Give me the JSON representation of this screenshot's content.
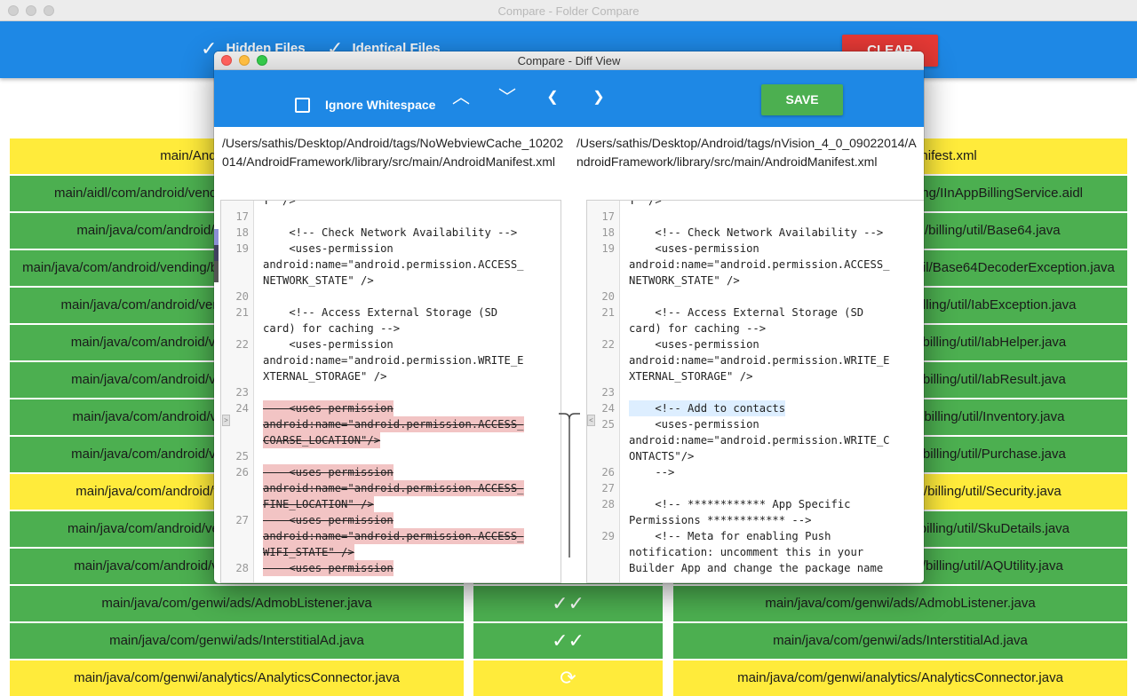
{
  "main_window": {
    "title": "Compare - Folder Compare",
    "toolbar": {
      "hidden_files_label": "Hidden Files",
      "identical_files_label": "Identical Files",
      "check_glyph": "✓",
      "clear_label": "CLEAR"
    },
    "rows": [
      {
        "left": "main/AndroidManifest.xml",
        "right": "main/AndroidManifest.xml",
        "status": "changed",
        "icon": "",
        "color": "#ffeb3b"
      },
      {
        "left": "main/aidl/com/android/vending/billing/IInAppBillingService.aidl",
        "right": "main/aidl/com/android/vending/billing/IInAppBillingService.aidl",
        "status": "identical",
        "icon": "",
        "color": "#4caf50"
      },
      {
        "left": "main/java/com/android/vending/billing/util/Base64.java",
        "right": "main/java/com/android/vending/billing/util/Base64.java",
        "status": "identical",
        "icon": "",
        "color": "#4caf50"
      },
      {
        "left": "main/java/com/android/vending/billing/util/Base64DecoderException.java",
        "right": "main/java/com/android/vending/billing/util/Base64DecoderException.java",
        "status": "identical",
        "icon": "",
        "color": "#4caf50"
      },
      {
        "left": "main/java/com/android/vending/billing/util/IabException.java",
        "right": "main/java/com/android/vending/billing/util/IabException.java",
        "status": "identical",
        "icon": "",
        "color": "#4caf50"
      },
      {
        "left": "main/java/com/android/vending/billing/util/IabHelper.java",
        "right": "main/java/com/android/vending/billing/util/IabHelper.java",
        "status": "identical",
        "icon": "",
        "color": "#4caf50"
      },
      {
        "left": "main/java/com/android/vending/billing/util/IabResult.java",
        "right": "main/java/com/android/vending/billing/util/IabResult.java",
        "status": "identical",
        "icon": "",
        "color": "#4caf50"
      },
      {
        "left": "main/java/com/android/vending/billing/util/Inventory.java",
        "right": "main/java/com/android/vending/billing/util/Inventory.java",
        "status": "identical",
        "icon": "",
        "color": "#4caf50"
      },
      {
        "left": "main/java/com/android/vending/billing/util/Purchase.java",
        "right": "main/java/com/android/vending/billing/util/Purchase.java",
        "status": "identical",
        "icon": "",
        "color": "#4caf50"
      },
      {
        "left": "main/java/com/android/vending/billing/util/Security.java",
        "right": "main/java/com/android/vending/billing/util/Security.java",
        "status": "changed",
        "icon": "",
        "color": "#ffeb3b"
      },
      {
        "left": "main/java/com/android/vending/billing/util/SkuDetails.java",
        "right": "main/java/com/android/vending/billing/util/SkuDetails.java",
        "status": "identical",
        "icon": "",
        "color": "#4caf50"
      },
      {
        "left": "main/java/com/android/vending/billing/util/AQUtility.java",
        "right": "main/java/com/android/vending/billing/util/AQUtility.java",
        "status": "identical",
        "icon": "",
        "color": "#4caf50"
      },
      {
        "left": "main/java/com/genwi/ads/AdmobListener.java",
        "right": "main/java/com/genwi/ads/AdmobListener.java",
        "status": "identical",
        "icon": "✓✓",
        "color": "#4caf50"
      },
      {
        "left": "main/java/com/genwi/ads/InterstitialAd.java",
        "right": "main/java/com/genwi/ads/InterstitialAd.java",
        "status": "identical",
        "icon": "✓✓",
        "color": "#4caf50"
      },
      {
        "left": "main/java/com/genwi/analytics/AnalyticsConnector.java",
        "right": "main/java/com/genwi/analytics/AnalyticsConnector.java",
        "status": "changed",
        "icon": "⟳",
        "color": "#ffeb3b"
      }
    ]
  },
  "diff_dialog": {
    "title": "Compare - Diff View",
    "ignore_whitespace_label": "Ignore Whitespace",
    "ignore_whitespace_checked": false,
    "nav": {
      "up": "︿",
      "down": "﹀",
      "left": "❮",
      "right": "❯"
    },
    "save_label": "SAVE",
    "left_path": "/Users/sathis/Desktop/Android/tags/NoWebviewCache_10202014/AndroidFramework/library/src/main/AndroidManifest.xml",
    "right_path": "/Users/sathis/Desktop/Android/tags/nVision_4_0_09022014/AndroidFramework/library/src/main/AndroidManifest.xml",
    "left_lines": [
      {
        "num": "",
        "text": "T\" />",
        "type": "normal"
      },
      {
        "num": "17",
        "text": "",
        "type": "normal"
      },
      {
        "num": "18",
        "text": "    <!-- Check Network Availability -->",
        "type": "normal"
      },
      {
        "num": "19",
        "text": "    <uses-permission",
        "type": "normal"
      },
      {
        "num": "",
        "text": "android:name=\"android.permission.ACCESS_",
        "type": "normal"
      },
      {
        "num": "",
        "text": "NETWORK_STATE\" />",
        "type": "normal"
      },
      {
        "num": "20",
        "text": "",
        "type": "normal"
      },
      {
        "num": "21",
        "text": "    <!-- Access External Storage (SD",
        "type": "normal"
      },
      {
        "num": "",
        "text": "card) for caching -->",
        "type": "normal"
      },
      {
        "num": "22",
        "text": "    <uses-permission",
        "type": "normal"
      },
      {
        "num": "",
        "text": "android:name=\"android.permission.WRITE_E",
        "type": "normal"
      },
      {
        "num": "",
        "text": "XTERNAL_STORAGE\" />",
        "type": "normal"
      },
      {
        "num": "23",
        "text": "",
        "type": "normal"
      },
      {
        "num": "24",
        "text": "    <uses-permission",
        "type": "deleted"
      },
      {
        "num": "",
        "text": "android:name=\"android.permission.ACCESS_",
        "type": "deleted"
      },
      {
        "num": "",
        "text": "COARSE_LOCATION\"/>",
        "type": "deleted"
      },
      {
        "num": "25",
        "text": "",
        "type": "normal"
      },
      {
        "num": "26",
        "text": "    <uses-permission",
        "type": "deleted"
      },
      {
        "num": "",
        "text": "android:name=\"android.permission.ACCESS_",
        "type": "deleted"
      },
      {
        "num": "",
        "text": "FINE_LOCATION\" />",
        "type": "deleted"
      },
      {
        "num": "27",
        "text": "    <uses-permission",
        "type": "deleted"
      },
      {
        "num": "",
        "text": "android:name=\"android.permission.ACCESS_",
        "type": "deleted"
      },
      {
        "num": "",
        "text": "WIFI_STATE\" />",
        "type": "deleted"
      },
      {
        "num": "28",
        "text": "    <uses-permission",
        "type": "deleted"
      }
    ],
    "right_lines": [
      {
        "num": "",
        "text": "T\" />",
        "type": "normal"
      },
      {
        "num": "17",
        "text": "",
        "type": "normal"
      },
      {
        "num": "18",
        "text": "    <!-- Check Network Availability -->",
        "type": "normal"
      },
      {
        "num": "19",
        "text": "    <uses-permission",
        "type": "normal"
      },
      {
        "num": "",
        "text": "android:name=\"android.permission.ACCESS_",
        "type": "normal"
      },
      {
        "num": "",
        "text": "NETWORK_STATE\" />",
        "type": "normal"
      },
      {
        "num": "20",
        "text": "",
        "type": "normal"
      },
      {
        "num": "21",
        "text": "    <!-- Access External Storage (SD",
        "type": "normal"
      },
      {
        "num": "",
        "text": "card) for caching -->",
        "type": "normal"
      },
      {
        "num": "22",
        "text": "    <uses-permission",
        "type": "normal"
      },
      {
        "num": "",
        "text": "android:name=\"android.permission.WRITE_E",
        "type": "normal"
      },
      {
        "num": "",
        "text": "XTERNAL_STORAGE\" />",
        "type": "normal"
      },
      {
        "num": "23",
        "text": "",
        "type": "normal"
      },
      {
        "num": "24",
        "text": "    <!-- Add to contacts",
        "type": "added"
      },
      {
        "num": "25",
        "text": "    <uses-permission",
        "type": "normal"
      },
      {
        "num": "",
        "text": "android:name=\"android.permission.WRITE_C",
        "type": "normal"
      },
      {
        "num": "",
        "text": "ONTACTS\"/>",
        "type": "normal"
      },
      {
        "num": "26",
        "text": "    -->",
        "type": "normal"
      },
      {
        "num": "27",
        "text": "",
        "type": "normal"
      },
      {
        "num": "28",
        "text": "    <!-- ************ App Specific",
        "type": "normal"
      },
      {
        "num": "",
        "text": "Permissions ************ -->",
        "type": "normal"
      },
      {
        "num": "29",
        "text": "    <!-- Meta for enabling Push",
        "type": "normal"
      },
      {
        "num": "",
        "text": "notification: uncomment this in your",
        "type": "normal"
      },
      {
        "num": "",
        "text": "Builder App and change the package name",
        "type": "normal"
      }
    ],
    "colors": {
      "accent": "#1e88e5",
      "save": "#4caf50",
      "clear": "#e53935",
      "deleted": "#f2c4c4",
      "added": "#ddeeff"
    }
  }
}
